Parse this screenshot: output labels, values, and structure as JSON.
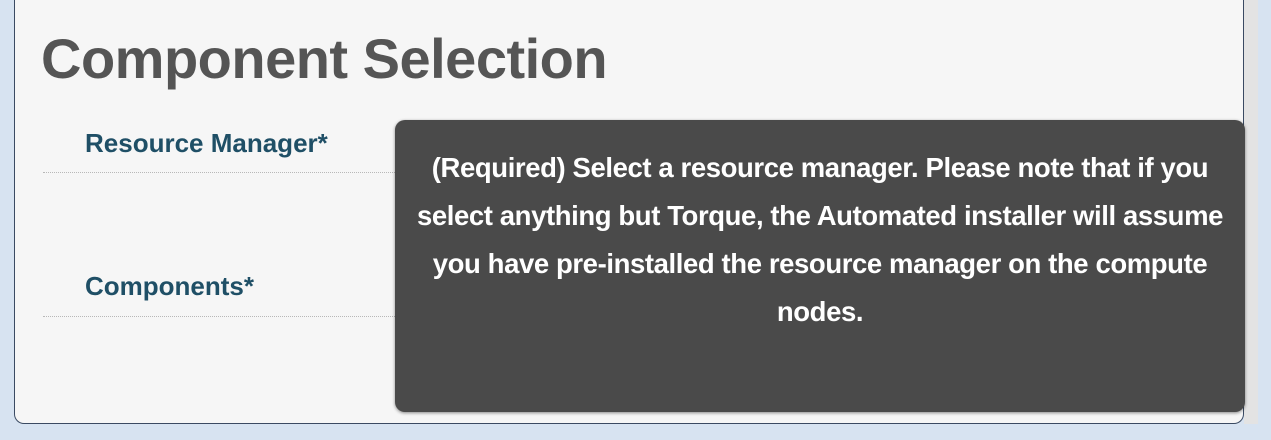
{
  "page": {
    "title": "Component Selection"
  },
  "form": {
    "resource_manager_label": "Resource Manager*",
    "components_label": "Components*"
  },
  "tooltip": {
    "text": "(Required) Select a resource manager. Please note that if you select anything but Torque, the Automated installer will assume you have pre-installed the resource manager on the compute nodes."
  },
  "colors": {
    "title": "#555555",
    "label": "#1f4f66",
    "tooltip_bg": "#4a4a4a",
    "tooltip_text": "#ffffff",
    "outer_bg": "#d7e3f1",
    "panel_bg": "#f6f6f6"
  }
}
